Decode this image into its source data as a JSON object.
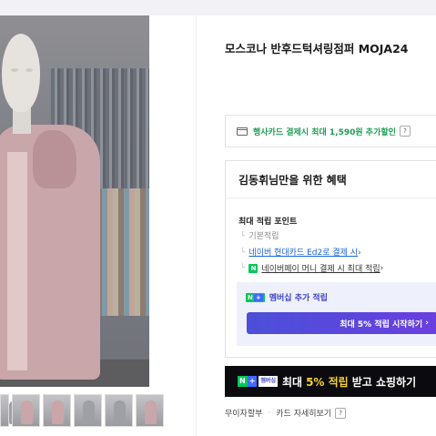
{
  "product": {
    "title": "모스코나 반후드턱셔링점퍼 MOJA24",
    "thumbnail_count": 6
  },
  "card_promo": {
    "text": "행사카드 결제시 최대 1,590원 추가할인",
    "help": "?"
  },
  "benefits": {
    "heading": "김동휘님만을 위한 혜택",
    "points_title": "최대 적립 포인트",
    "rows": [
      "기본적립",
      "네이버 현대카드 Ed2로 결제 시",
      "네이버페이 머니 결제 시 최대 적립"
    ],
    "naverplus": {
      "label": "멤버십 추가 적립",
      "button": "최대 5% 적립 시작하기"
    }
  },
  "banner": {
    "badge": "멤버십",
    "text_before": "최대",
    "highlight": "5% 적립",
    "text_after": "받고 쇼핑하기"
  },
  "installment": {
    "label": "무이자할부",
    "link": "카드 자세히보기",
    "help": "?"
  },
  "colors": {
    "accent_green": "#1f9e57",
    "naver_green": "#03c75a",
    "button_purple": "#4b4fd8",
    "link_blue": "#1b63d8"
  }
}
